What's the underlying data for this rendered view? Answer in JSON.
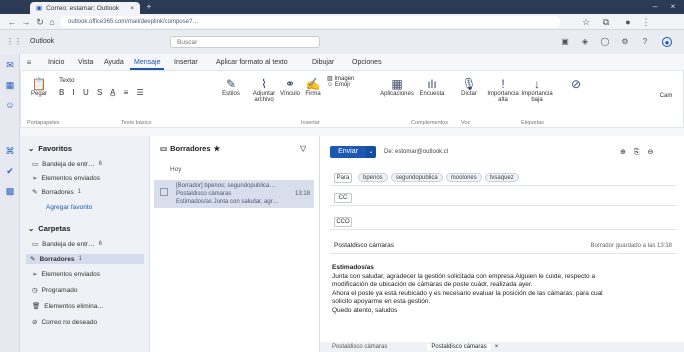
{
  "browser": {
    "tab_title": "Correo: estamar; Outlook",
    "url": "outlook.office365.com/mail/deeplink/compose?…",
    "icons": [
      "back-icon",
      "forward-icon",
      "reload-icon",
      "home-icon"
    ]
  },
  "app": {
    "name": "Outlook",
    "search_placeholder": "Buscar"
  },
  "ribbon": {
    "tabs": [
      "Inicio",
      "Vista",
      "Ayuda",
      "Mensaje",
      "Insertar",
      "Aplicar formato al texto",
      "Dibujar",
      "Opciones"
    ],
    "active_tab": "Mensaje",
    "tools": [
      {
        "icon": "clipboard-icon",
        "label": "Pegar"
      },
      {
        "icon": "paragraph-icon",
        "label": "Texto"
      },
      {
        "icon": "draw-icon",
        "label": "Estilos"
      },
      {
        "icon": "attach-icon",
        "label": "Adjuntar archivo"
      },
      {
        "icon": "link-icon",
        "label": "Vínculo"
      },
      {
        "icon": "signature-icon",
        "label": "Firma"
      },
      {
        "icon": "image-icon",
        "label": "Imagen"
      },
      {
        "icon": "emoji-icon",
        "label": "Emoji"
      },
      {
        "icon": "apps-icon",
        "label": "Aplicaciones"
      },
      {
        "icon": "poll-icon",
        "label": "Encuesta"
      },
      {
        "icon": "mic-icon",
        "label": "Dictar"
      },
      {
        "icon": "importance-high-icon",
        "label": "Importancia alta"
      },
      {
        "icon": "importance-low-icon",
        "label": "Importancia baja"
      },
      {
        "icon": "sensitivity-icon",
        "label": "Cam"
      }
    ],
    "groups": [
      "Portapapeles",
      "Texto básico",
      "Insertar",
      "Complementos",
      "Voz",
      "Etiquetas"
    ]
  },
  "folders": {
    "favorites_label": "Favoritos",
    "favorites": [
      {
        "label": "Bandeja de entr…",
        "count": "6"
      },
      {
        "label": "Elementos enviados",
        "count": ""
      },
      {
        "label": "Borradores",
        "count": "1"
      }
    ],
    "add_favorite": "Agregar favorito",
    "folders_label": "Carpetas",
    "folders": [
      {
        "label": "Bandeja de entr…",
        "count": "6"
      },
      {
        "label": "Borradores",
        "count": "1"
      },
      {
        "label": "Elementos enviados",
        "count": ""
      },
      {
        "label": "Programado",
        "count": ""
      },
      {
        "label": "Elementos elimina…",
        "count": ""
      },
      {
        "label": "Correo no deseado",
        "count": ""
      }
    ]
  },
  "message_list": {
    "title": "Borradores",
    "group": "Hoy",
    "item_line1": "[Borrador] bpenos; segundopublica…",
    "item_subject": "Postaldisco cámaras",
    "item_time": "13:18",
    "item_preview": "Estimados/as Junta con saludar, agr…"
  },
  "compose": {
    "send_label": "Enviar",
    "from": "De: estomar@outlook.cl",
    "to_label": "Para",
    "to_chips": [
      "bpenos",
      "segundopublica",
      "moolones",
      "tvsaquez"
    ],
    "cc_label": "CC",
    "cco_label": "CCO",
    "subject": "Postaldisco cámaras",
    "saved_at": "Borrador guardado a las 13:18",
    "body_lines": [
      "Estimados/as",
      "Junta con saludar, agradecer la gestión solicitada con empresa Alguien le cuide, respecto a",
      "modificación de ubicación de cámaras de poste cuádr, realizada ayer.",
      "Ahora el poste ya está reubicado y es necesario evaluar la posición de las cámaras, para cual",
      "solicito apoyarme en esta gestión.",
      "Quedo atento, saludos"
    ],
    "bottom_tabs": [
      "Postaldisco cámaras",
      "Postaldisco cámaras"
    ]
  }
}
